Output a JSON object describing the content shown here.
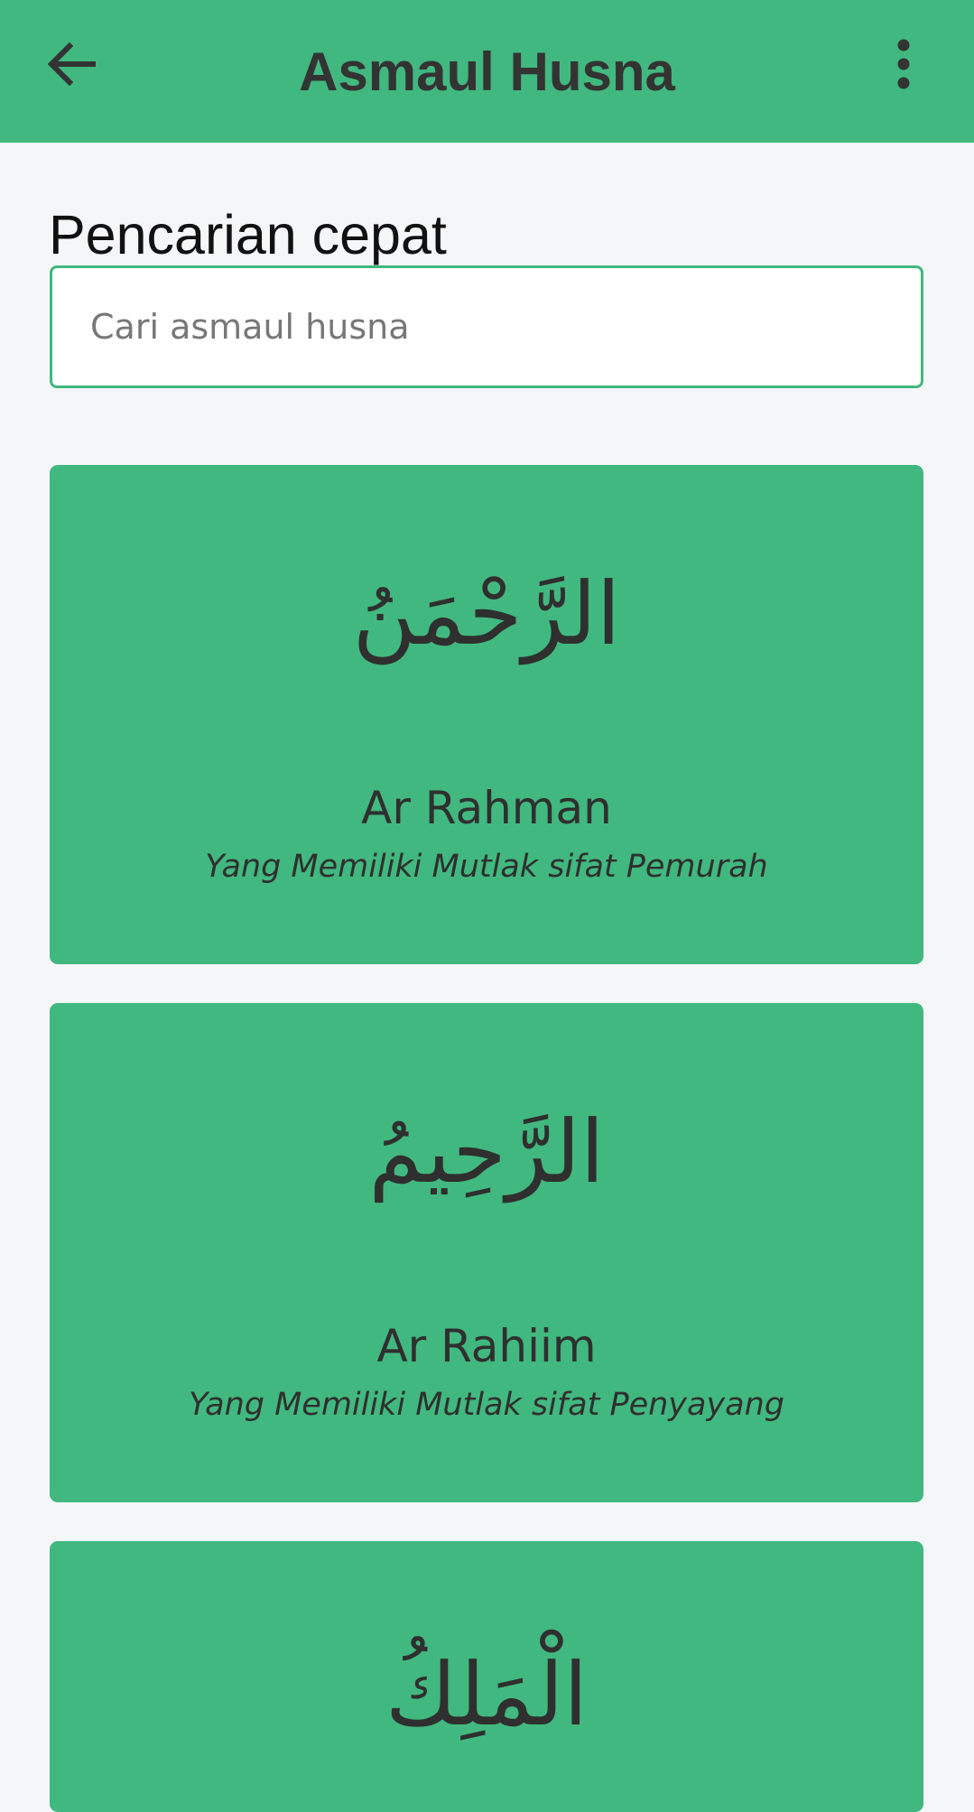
{
  "appbar": {
    "title": "Asmaul Husna",
    "back_icon": "arrow-left-icon",
    "menu_icon": "more-vertical-icon",
    "background": "#41b87f"
  },
  "search": {
    "label": "Pencarian cepat",
    "placeholder": "Cari asmaul husna",
    "value": ""
  },
  "names": [
    {
      "arabic": "الرَّحْمَنُ",
      "latin": "Ar Rahman",
      "meaning": "Yang Memiliki Mutlak sifat Pemurah"
    },
    {
      "arabic": "الرَّحِيمُ",
      "latin": "Ar Rahiim",
      "meaning": "Yang Memiliki Mutlak sifat Penyayang"
    },
    {
      "arabic": "الْمَلِكُ",
      "latin": "",
      "meaning": ""
    }
  ],
  "colors": {
    "accent": "#41b87f",
    "page_background": "#f5f6f8",
    "text_dark": "#333333"
  }
}
